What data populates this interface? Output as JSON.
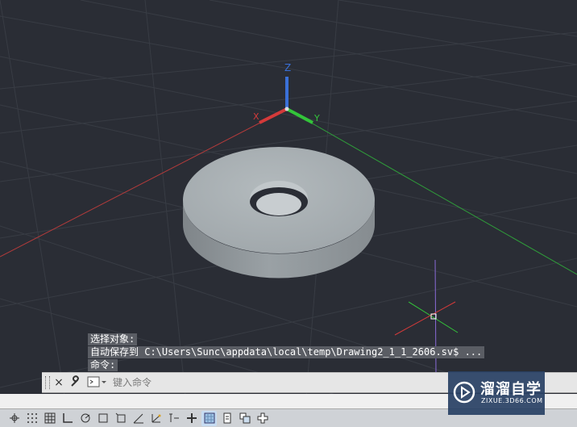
{
  "viewport": {
    "background": "#2a2d35",
    "axes": {
      "x_label": "X",
      "y_label": "Y",
      "z_label": "Z"
    },
    "colors": {
      "x_axis": "#d43a3a",
      "y_axis": "#33c43a",
      "z_axis": "#3a70d8",
      "washer_top": "#a7aeb2",
      "washer_side": "#8d9498",
      "hole": "#b9bfc2"
    }
  },
  "command_history": [
    "选择对象:",
    "自动保存到 C:\\Users\\Sunc\\appdata\\local\\temp\\Drawing2_1_1_2606.sv$ ...",
    "命令:"
  ],
  "command_line": {
    "placeholder": "键入命令",
    "close_icon": "×",
    "customize_icon": "wrench-icon",
    "prompt_icon": "command-prompt-icon"
  },
  "status_bar": {
    "buttons": [
      {
        "name": "model-space-icon",
        "on": false
      },
      {
        "name": "snap-icon",
        "on": false
      },
      {
        "name": "grid-icon",
        "on": false
      },
      {
        "name": "ortho-icon",
        "on": false
      },
      {
        "name": "polar-icon",
        "on": false
      },
      {
        "name": "osnap-icon",
        "on": false
      },
      {
        "name": "3d-osnap-icon",
        "on": false
      },
      {
        "name": "otrack-icon",
        "on": false
      },
      {
        "name": "ducs-icon",
        "on": false
      },
      {
        "name": "dyn-icon",
        "on": false
      },
      {
        "name": "lineweight-icon",
        "on": false
      },
      {
        "name": "transparency-icon",
        "on": true
      },
      {
        "name": "quick-properties-icon",
        "on": false
      },
      {
        "name": "selection-cycling-icon",
        "on": false
      },
      {
        "name": "annotation-monitor-icon",
        "on": false
      }
    ]
  },
  "watermark": {
    "title": "溜溜自学",
    "url": "ZIXUE.3D66.COM"
  }
}
